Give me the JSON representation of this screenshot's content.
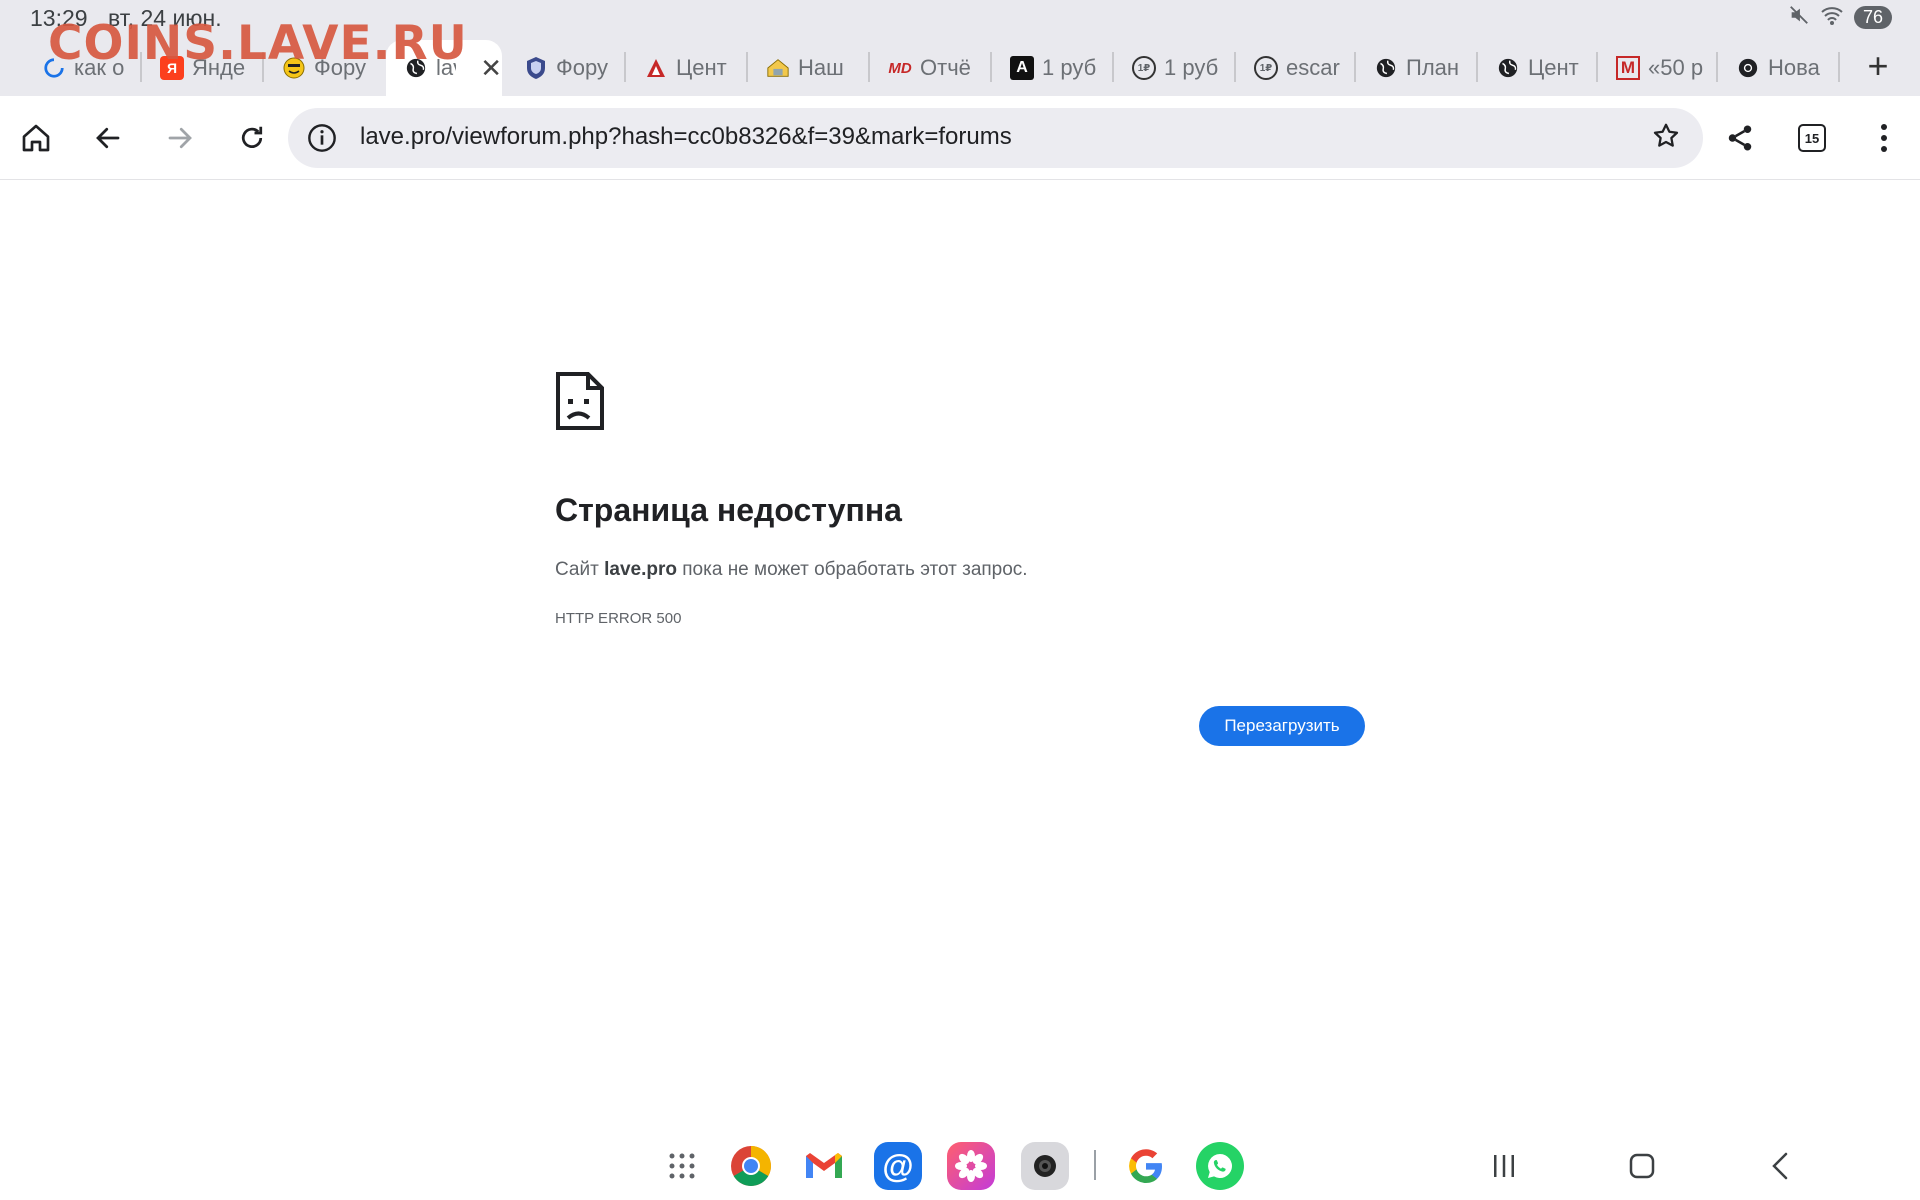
{
  "status_bar": {
    "time": "13:29",
    "date": "вт, 24 июн.",
    "battery": "76",
    "icons": [
      "mute-icon",
      "wifi-icon",
      "battery-icon"
    ]
  },
  "watermark": "COINS.LAVE.RU",
  "tabs": [
    {
      "label": "как о",
      "favicon": "loading-spinner-icon"
    },
    {
      "label": "Янде",
      "favicon": "yandex-icon"
    },
    {
      "label": "Фору",
      "favicon": "smiley-icon"
    },
    {
      "label": "lav",
      "favicon": "globe-icon",
      "active": true
    },
    {
      "label": "Фору",
      "favicon": "shield-icon"
    },
    {
      "label": "Цент",
      "favicon": "bank-icon"
    },
    {
      "label": "Наш",
      "favicon": "house-icon"
    },
    {
      "label": "Отчё",
      "favicon": "md-icon",
      "favicon_text": "MD"
    },
    {
      "label": "1 руб",
      "favicon": "a-icon",
      "favicon_text": "A"
    },
    {
      "label": "1 руб",
      "favicon": "coin-icon",
      "favicon_text": "1₽"
    },
    {
      "label": "escar",
      "favicon": "coin-icon",
      "favicon_text": "1₽"
    },
    {
      "label": "План",
      "favicon": "globe-icon"
    },
    {
      "label": "Цент",
      "favicon": "globe-icon"
    },
    {
      "label": "«50 р",
      "favicon": "m-icon",
      "favicon_text": "M"
    },
    {
      "label": "Нова",
      "favicon": "chrome-icon"
    }
  ],
  "toolbar": {
    "url": "lave.pro/viewforum.php?hash=cc0b8326&f=39&mark=forums",
    "tab_count": "15"
  },
  "error_page": {
    "title": "Страница недоступна",
    "desc_prefix": "Сайт ",
    "desc_site": "lave.pro",
    "desc_suffix": " пока не может обработать этот запрос.",
    "code": "HTTP ERROR 500",
    "reload_label": "Перезагрузить"
  },
  "dock": {
    "apps": [
      "apps-grid-icon",
      "chrome-icon",
      "gmail-icon",
      "mail-at-icon",
      "gallery-icon",
      "camera-icon",
      "google-icon",
      "whatsapp-icon"
    ],
    "nav": [
      "recents-icon",
      "home-icon",
      "back-icon"
    ]
  },
  "colors": {
    "accent": "#1a73e8",
    "tabstrip_bg": "#e9e9ee",
    "omnibox_bg": "#ececf1",
    "watermark": "#d65840"
  }
}
